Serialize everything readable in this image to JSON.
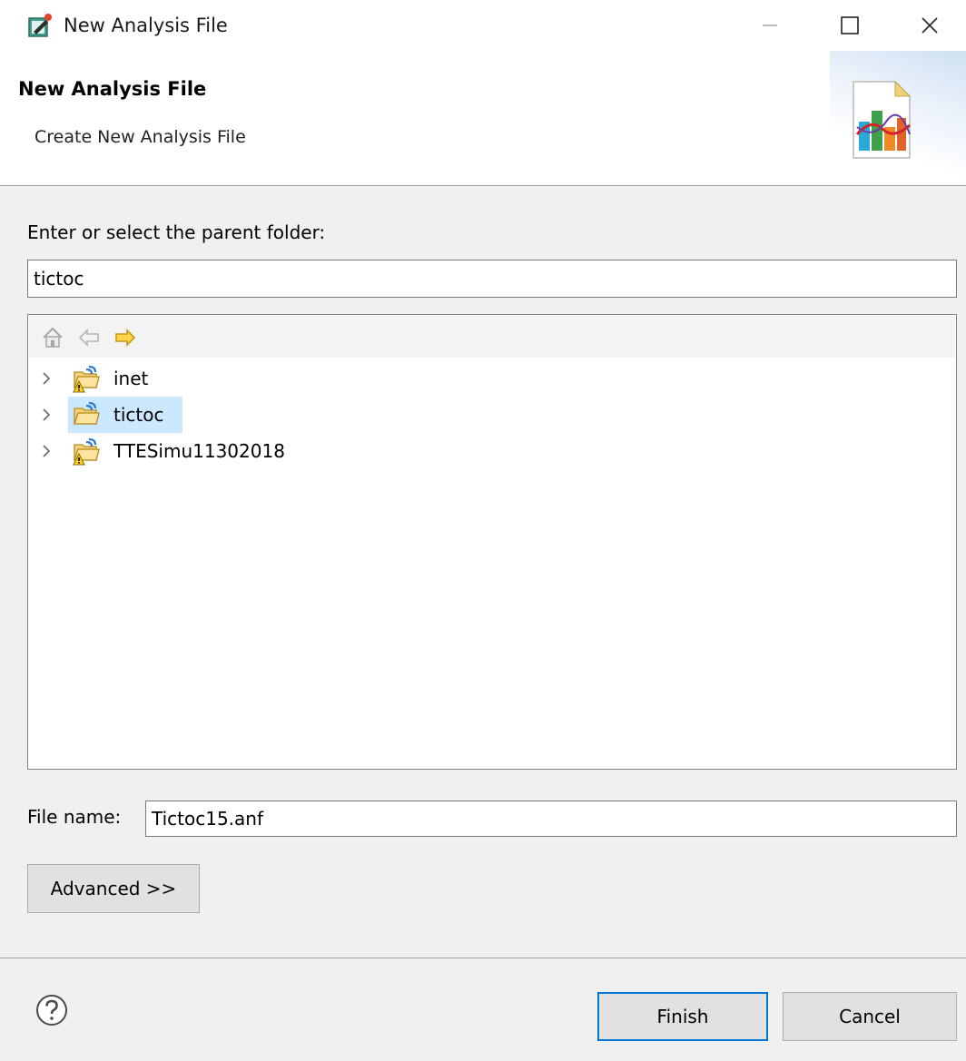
{
  "window": {
    "title": "New Analysis File",
    "icon": "analysis-file-edit-icon",
    "controls": [
      "minimize-icon",
      "maximize-icon",
      "close-icon"
    ]
  },
  "header": {
    "title": "New Analysis File",
    "description": "Create New Analysis File",
    "graphic": "analysis-chart-icon"
  },
  "folder": {
    "label": "Enter or select the parent folder:",
    "value": "tictoc"
  },
  "tree": {
    "toolbar": [
      "home-icon",
      "back-arrow-icon",
      "forward-arrow-icon"
    ],
    "items": [
      {
        "label": "inet",
        "icon": "project-folder-warning-icon",
        "selected": false
      },
      {
        "label": "tictoc",
        "icon": "project-folder-open-icon",
        "selected": true
      },
      {
        "label": "TTESimu11302018",
        "icon": "project-folder-warning-icon",
        "selected": false
      }
    ]
  },
  "file": {
    "label": "File name:",
    "value": "Tictoc15.anf"
  },
  "buttons": {
    "advanced": "Advanced >>",
    "finish": "Finish",
    "cancel": "Cancel"
  },
  "colors": {
    "selection": "#cce8ff",
    "accent": "#0078d7",
    "forward_arrow": "#f5b800"
  }
}
